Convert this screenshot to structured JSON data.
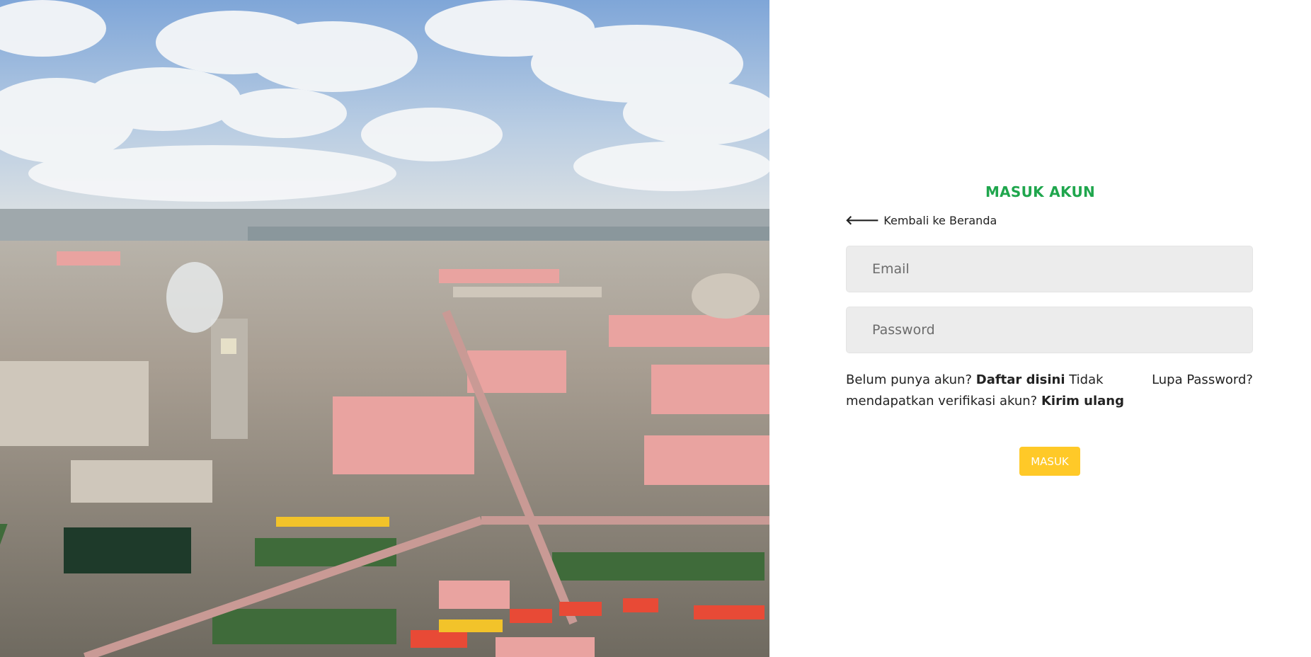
{
  "form": {
    "title": "MASUK AKUN",
    "back_label": "Kembali ke Beranda",
    "email_placeholder": "Email",
    "password_placeholder": "Password",
    "no_account_text": "Belum punya akun?",
    "register_link": "Daftar disini",
    "no_verification_text": "Tidak mendapatkan verifikasi akun?",
    "resend_link": "Kirim ulang",
    "forgot_password": "Lupa Password?",
    "submit_label": "MASUK"
  },
  "colors": {
    "title": "#1fa64d",
    "button": "#ffc928",
    "field_bg": "#ececec"
  },
  "icons": {
    "back": "arrow-left-icon"
  }
}
